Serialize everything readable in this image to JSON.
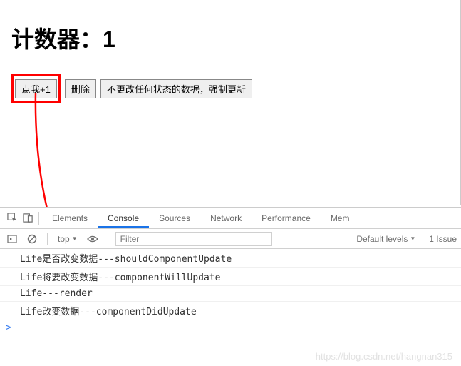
{
  "page": {
    "title_prefix": "计数器：",
    "count": "1",
    "buttons": {
      "increment": "点我+1",
      "delete": "删除",
      "force": "不更改任何状态的数据，强制更新"
    }
  },
  "devtools": {
    "tabs": {
      "elements": "Elements",
      "console": "Console",
      "sources": "Sources",
      "network": "Network",
      "performance": "Performance",
      "memory": "Mem"
    },
    "toolbar": {
      "context": "top",
      "filter_placeholder": "Filter",
      "levels": "Default levels",
      "issues": "1 Issue"
    },
    "logs": [
      "Life是否改变数据---shouldComponentUpdate",
      "Life将要改变数据---componentWillUpdate",
      "Life---render",
      "Life改变数据---componentDidUpdate"
    ],
    "prompt": ">"
  },
  "watermark": "https://blog.csdn.net/hangnan315"
}
